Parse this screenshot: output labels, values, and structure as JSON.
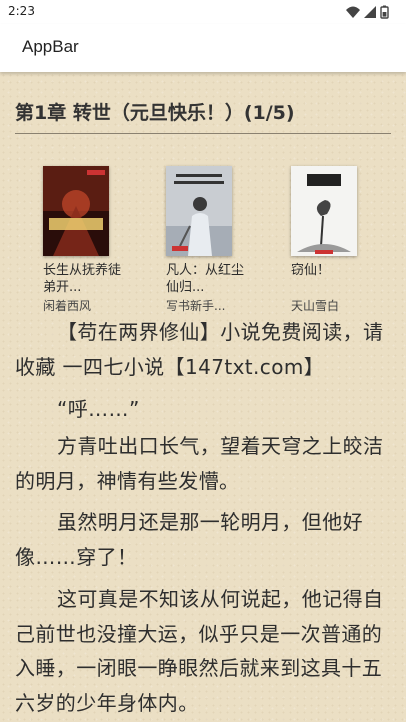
{
  "status": {
    "time": "2:23"
  },
  "appbar": {
    "title": "AppBar"
  },
  "chapter": {
    "title": "第1章 转世（元旦快乐！）(1/5)"
  },
  "books": [
    {
      "title": "长生从抚养徒弟开...",
      "author": "闲着西风",
      "cover_text": "何者为伏妖女"
    },
    {
      "title": "凡人：从红尘仙归...",
      "author": "写书新手...",
      "cover_text": "凡人 从红尘仙归来的韩立"
    },
    {
      "title": "窃仙！",
      "author": "天山雪白",
      "cover_text": "窃仙"
    }
  ],
  "content": {
    "p1": "【苟在两界修仙】小说免费阅读，请收藏 一四七小说【147txt.com】",
    "p2": "“呼……”",
    "p3": "方青吐出口长气，望着天穹之上皎洁的明月，神情有些发懵。",
    "p4": "虽然明月还是那一轮明月，但他好像……穿了！",
    "p5": "这可真是不知该从何说起，他记得自己前世也没撞大运，似乎只是一次普通的入睡，一闭眼一睁眼然后就来到这具十五六岁的少年身体内。"
  }
}
